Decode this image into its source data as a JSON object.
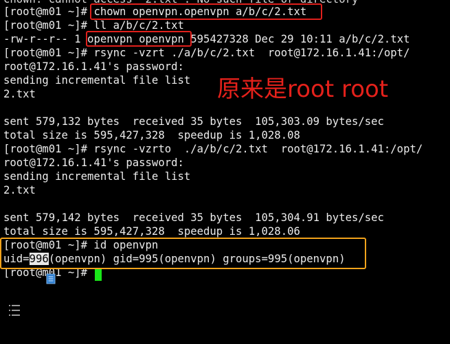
{
  "terminal": {
    "colors": {
      "background": "#000000",
      "text": "#ececec",
      "cursor": "#19e619",
      "highlight_red": "#e0201c",
      "highlight_orange": "#f2a31b",
      "annotation": "#e4211b"
    },
    "cut_line": "chown: cannot access '2.txt': No such file or directory",
    "lines": [
      {
        "prefix": "[root@m01 ~]# ",
        "cmd": "chown openvpn.openvpn a/b/c/2.txt"
      },
      {
        "text": "[root@m01 ~]# ll a/b/c/2.txt"
      },
      {
        "prefix": "-rw-r--r-- 1 ",
        "owner": "openvpn openvpn",
        "rest": " 595427328 Dec 29 10:11 a/b/c/2.txt"
      },
      {
        "text": "[root@m01 ~]# rsync -vzrt ./a/b/c/2.txt  root@172.16.1.41:/opt/"
      },
      {
        "text": "root@172.16.1.41's password:"
      },
      {
        "text": "sending incremental file list"
      },
      {
        "text": "2.txt"
      },
      {
        "text": ""
      },
      {
        "text": "sent 579,132 bytes  received 35 bytes  105,303.09 bytes/sec"
      },
      {
        "text": "total size is 595,427,328  speedup is 1,028.08"
      },
      {
        "text": "[root@m01 ~]# rsync -vzrto  ./a/b/c/2.txt  root@172.16.1.41:/opt/"
      },
      {
        "text": "root@172.16.1.41's password:"
      },
      {
        "text": "sending incremental file list"
      },
      {
        "text": "2.txt"
      },
      {
        "text": ""
      },
      {
        "text": "sent 579,142 bytes  received 35 bytes  105,304.91 bytes/sec"
      },
      {
        "text": "total size is 595,427,328  speedup is 1,028.06"
      },
      {
        "text": "[root@m01 ~]# id openvpn"
      },
      {
        "prefix": "uid=",
        "uid": "996",
        "rest": "(openvpn) gid=995(openvpn) groups=995(openvpn)"
      },
      {
        "prompt": "[root@m01 ~]# "
      }
    ],
    "annotation": "原来是root root",
    "icons": [
      "document-icon",
      "list-icon"
    ]
  }
}
